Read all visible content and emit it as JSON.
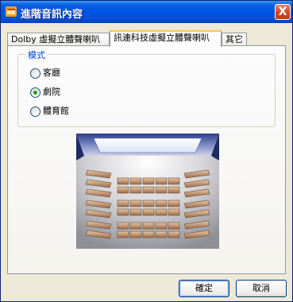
{
  "window": {
    "title": "進階音訊內容",
    "close_label": "X"
  },
  "tabs": [
    {
      "label": "Dolby 虛擬立體聲喇叭"
    },
    {
      "label": "訊連科技虛擬立體聲喇叭"
    },
    {
      "label": "其它"
    }
  ],
  "active_tab": 1,
  "mode_group": {
    "title": "模式",
    "options": [
      {
        "label": "客廳",
        "selected": false
      },
      {
        "label": "劇院",
        "selected": true
      },
      {
        "label": "體育館",
        "selected": false
      }
    ]
  },
  "buttons": {
    "ok": "確定",
    "cancel": "取消"
  },
  "colors": {
    "title_bar": "#0054e3",
    "group_title": "#0046d5",
    "radio_selected": "#21a121",
    "active_tab_highlight": "#ffc83c",
    "close_button": "#d3471f"
  },
  "icons": {
    "app": "app-icon",
    "close": "close-icon",
    "preview": "theater-preview"
  }
}
